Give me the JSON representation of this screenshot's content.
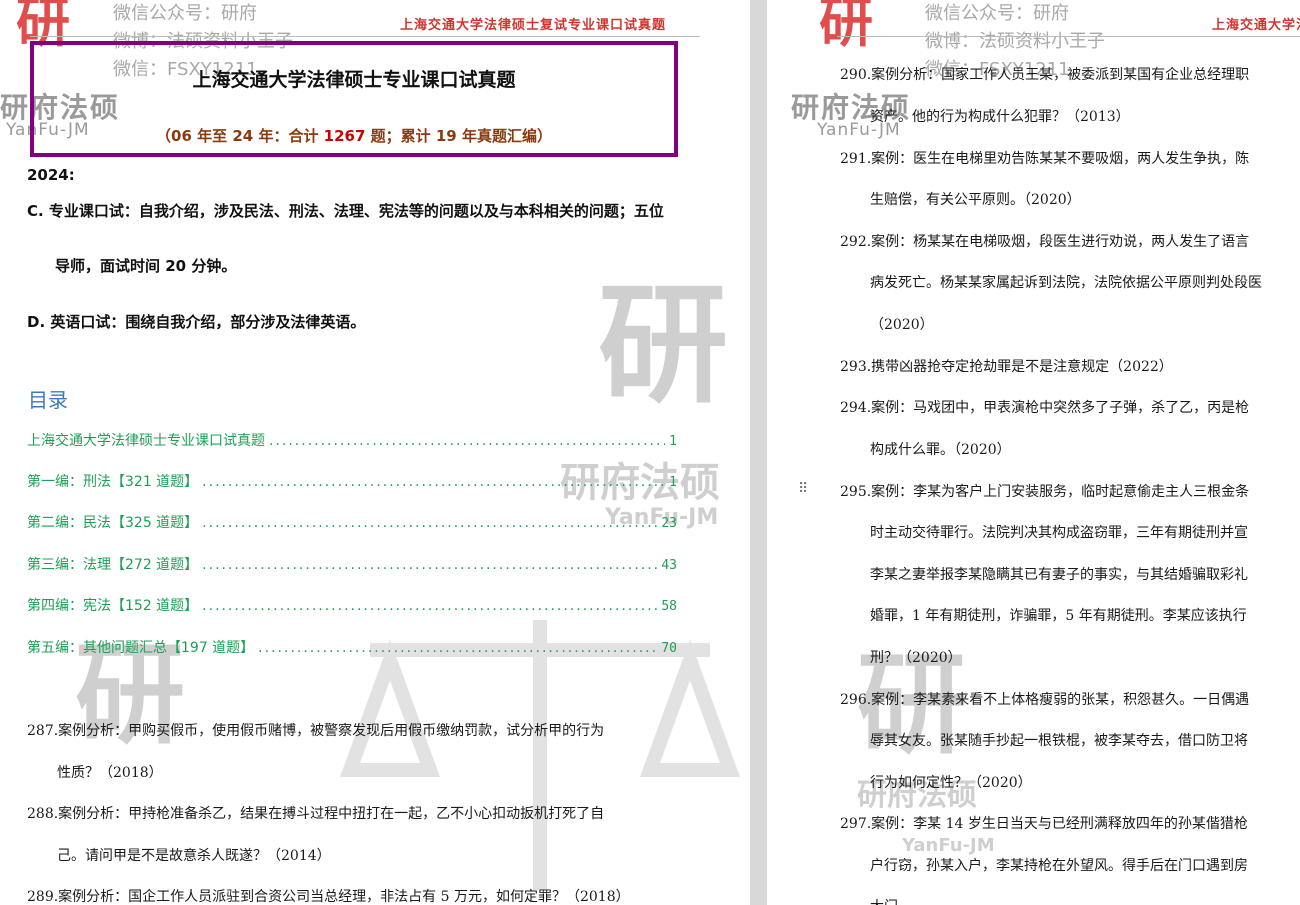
{
  "watermark": {
    "seal": "研",
    "brand_cn": "研府法硕",
    "brand_en": "YanFu-JM",
    "wechat_official": "微信公众号：研府",
    "weibo": "微博：法硕资料小王子",
    "wechat": "微信：FSXY1211"
  },
  "left_page": {
    "header_doc_title": "上海交通大学法律硕士复试专业课口试真题",
    "title": "上海交通大学法律硕士专业课口试真题",
    "subtitle_pre": "（06 年至 24 年：合计 ",
    "subtitle_num": "1267",
    "subtitle_post": " 题；累计 19 年真题汇编）",
    "year": "2024:",
    "item_c_1": "C.   专业课口试：自我介绍，涉及民法、刑法、法理、宪法等的问题以及与本科相关的问题；五位",
    "item_c_2": "导师，面试时间 20 分钟。",
    "item_d": "D.   英语口试：围绕自我介绍，部分涉及法律英语。",
    "toc_heading": "目录",
    "toc": [
      {
        "label": "上海交通大学法律硕士专业课口试真题",
        "page": "1"
      },
      {
        "label": "第一编：刑法【321 道题】",
        "page": "1"
      },
      {
        "label": "第二编：民法【325 道题】",
        "page": "23"
      },
      {
        "label": "第三编：法理【272 道题】",
        "page": "43"
      },
      {
        "label": "第四编：宪法【152 道题】",
        "page": "58"
      },
      {
        "label": "第五编：其他问题汇总【197 道题】",
        "page": "70"
      }
    ],
    "questions": [
      "287.案例分析：甲购买假币，使用假币赌博，被警察发现后用假币缴纳罚款，试分析甲的行为",
      "性质？（2018）",
      "288.案例分析：甲持枪准备杀乙，结果在搏斗过程中扭打在一起，乙不小心扣动扳机打死了自",
      "己。请问甲是不是故意杀人既遂？（2014）",
      "289.案例分析：国企工作人员派驻到合资公司当总经理，非法占有 5 万元，如何定罪？（2018）"
    ]
  },
  "right_page": {
    "header_doc_title": "上海交通大学法",
    "lines": [
      "290.案例分析：国家工作人员王某，被委派到某国有企业总经理职",
      "资产。他的行为构成什么犯罪？（2013）",
      "291.案例：医生在电梯里劝告陈某某不要吸烟，两人发生争执，陈",
      "生赔偿，有关公平原则。（2020）",
      "292.案例：杨某某在电梯吸烟，段医生进行劝说，两人发生了语言",
      "病发死亡。杨某某家属起诉到法院，法院依据公平原则判处段医",
      "（2020）",
      "293.携带凶器抢夺定抢劫罪是不是注意规定（2022）",
      "294.案例：马戏团中，甲表演枪中突然多了子弹，杀了乙，丙是枪",
      "构成什么罪。（2020）",
      "295.案例：李某为客户上门安装服务，临时起意偷走主人三根金条",
      "时主动交待罪行。法院判决其构成盗窃罪，三年有期徒刑并宣",
      "李某之妻举报李某隐瞒其已有妻子的事实，与其结婚骗取彩礼",
      "婚罪，1 年有期徒刑，诈骗罪，5 年有期徒刑。李某应该执行",
      "刑？（2020）",
      "296.案例：李某素来看不上体格瘦弱的张某，积怨甚久。一日偶遇",
      "辱其女友。张某随手抄起一根铁棍，被李某夺去，借口防卫将",
      "行为如何定性？（2020）",
      "297.案例：李某 14 岁生日当天与已经刑满释放四年的孙某偕猎枪",
      "户行窃，孙某入户，李某持枪在外望风。得手后在门口遇到房",
      "大门"
    ]
  }
}
